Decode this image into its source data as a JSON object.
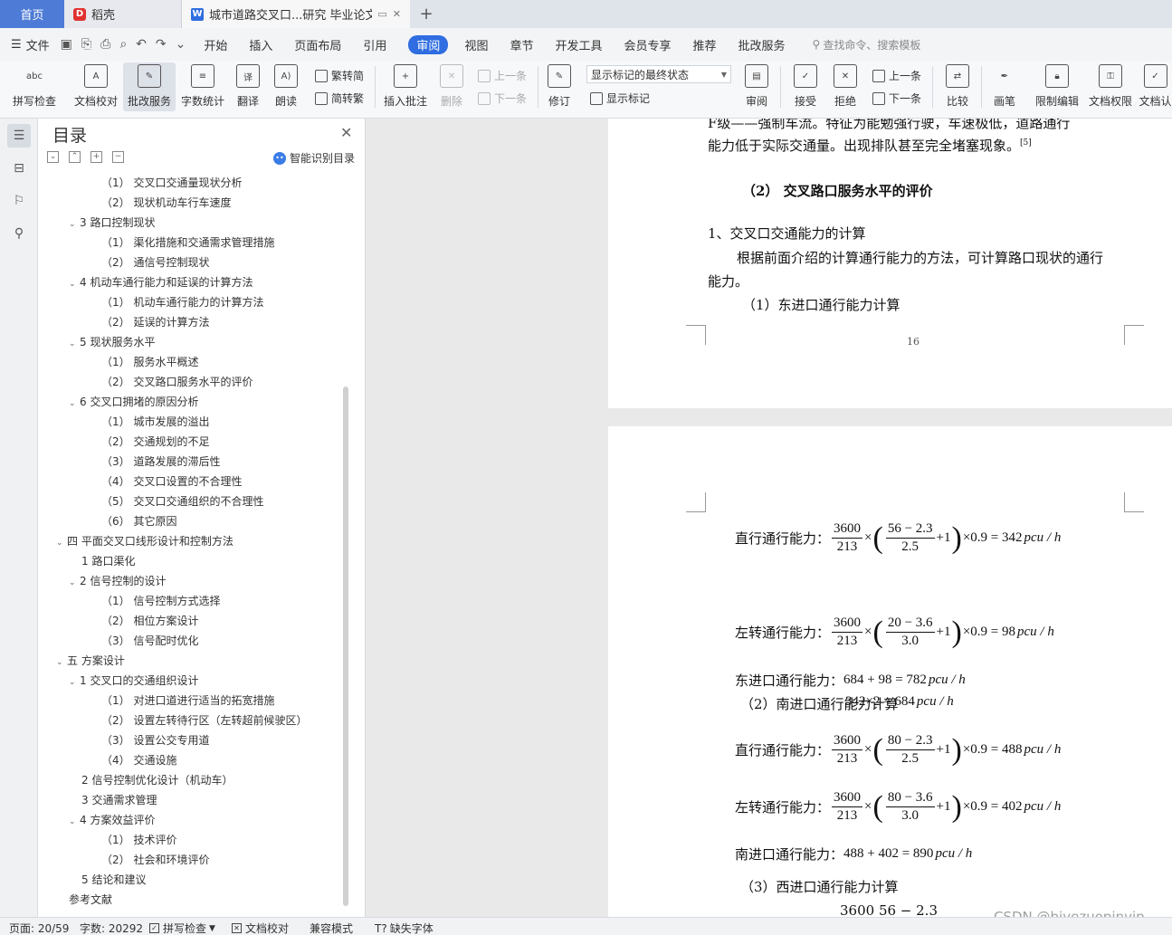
{
  "tabs": {
    "home": "首页",
    "daoke": "稻壳",
    "doc_title": "城市道路交叉口...研究 毕业论文"
  },
  "menu": {
    "file": "文件",
    "items": [
      "开始",
      "插入",
      "页面布局",
      "引用",
      "审阅",
      "视图",
      "章节",
      "开发工具",
      "会员专享",
      "推荐",
      "批改服务"
    ],
    "active": "审阅",
    "search_placeholder": "查找命令、搜索模板"
  },
  "ribbon": {
    "spell": "拼写检查",
    "doc_check": "文档校对",
    "grading": "批改服务",
    "word_count": "字数统计",
    "translate": "翻译",
    "read_aloud": "朗读",
    "trad": "繁转简",
    "simp": "简转繁",
    "insert_comment": "插入批注",
    "delete": "删除",
    "prev": "上一条",
    "next": "下一条",
    "track": "修订",
    "markup_select": "显示标记的最终状态",
    "show_markup": "显示标记",
    "review": "审阅",
    "accept": "接受",
    "reject": "拒绝",
    "prev2": "上一条",
    "next2": "下一条",
    "compare": "比较",
    "pen": "画笔",
    "restrict": "限制编辑",
    "rights": "文档权限",
    "auth": "文档认"
  },
  "toc": {
    "title": "目录",
    "smart": "智能识别目录",
    "items": [
      {
        "text": "（1） 交叉口交通量现状分析",
        "lvl": 2
      },
      {
        "text": "（2） 现状机动车行车速度",
        "lvl": 2
      },
      {
        "text": "3 路口控制现状",
        "lvl": 1,
        "car": "⌄"
      },
      {
        "text": "（1） 渠化措施和交通需求管理措施",
        "lvl": 2
      },
      {
        "text": "（2） 通信号控制现状",
        "lvl": 2
      },
      {
        "text": "4 机动车通行能力和延误的计算方法",
        "lvl": 1,
        "car": "⌄"
      },
      {
        "text": "（1） 机动车通行能力的计算方法",
        "lvl": 2
      },
      {
        "text": "（2） 延误的计算方法",
        "lvl": 2
      },
      {
        "text": "5 现状服务水平",
        "lvl": 1,
        "car": "⌄"
      },
      {
        "text": "（1） 服务水平概述",
        "lvl": 2
      },
      {
        "text": "（2） 交叉路口服务水平的评价",
        "lvl": 2
      },
      {
        "text": "6 交叉口拥堵的原因分析",
        "lvl": 1,
        "car": "⌄"
      },
      {
        "text": "（1） 城市发展的溢出",
        "lvl": 2
      },
      {
        "text": "（2） 交通规划的不足",
        "lvl": 2
      },
      {
        "text": "（3） 道路发展的滞后性",
        "lvl": 2
      },
      {
        "text": "（4） 交叉口设置的不合理性",
        "lvl": 2
      },
      {
        "text": "（5） 交叉口交通组织的不合理性",
        "lvl": 2
      },
      {
        "text": "（6） 其它原因",
        "lvl": 2
      },
      {
        "text": "四 平面交叉口线形设计和控制方法",
        "lvl": 0,
        "car": "⌄"
      },
      {
        "text": "1 路口渠化",
        "lvl": 1
      },
      {
        "text": "2 信号控制的设计",
        "lvl": 1,
        "car": "⌄"
      },
      {
        "text": "（1） 信号控制方式选择",
        "lvl": 2
      },
      {
        "text": "（2） 相位方案设计",
        "lvl": 2
      },
      {
        "text": "（3） 信号配时优化",
        "lvl": 2
      },
      {
        "text": "五 方案设计",
        "lvl": 0,
        "car": "⌄"
      },
      {
        "text": "1 交叉口的交通组织设计",
        "lvl": 1,
        "car": "⌄"
      },
      {
        "text": "（1） 对进口道进行适当的拓宽措施",
        "lvl": 2
      },
      {
        "text": "（2） 设置左转待行区（左转超前候驶区）",
        "lvl": 2
      },
      {
        "text": "（3） 设置公交专用道",
        "lvl": 2
      },
      {
        "text": "（4） 交通设施",
        "lvl": 2
      },
      {
        "text": "2 信号控制优化设计（机动车）",
        "lvl": 1
      },
      {
        "text": "3 交通需求管理",
        "lvl": 1
      },
      {
        "text": "4 方案效益评价",
        "lvl": 1,
        "car": "⌄"
      },
      {
        "text": "（1） 技术评价",
        "lvl": 2
      },
      {
        "text": "（2） 社会和环境评价",
        "lvl": 2
      },
      {
        "text": "5 结论和建议",
        "lvl": 1
      },
      {
        "text": "参考文献",
        "lvl": 0
      }
    ]
  },
  "page1": {
    "line1": "F级——强制车流。特征为能勉强行驶，车速极低，道路通行",
    "line2": "能力低于实际交通量。出现排队甚至完全堵塞现象。",
    "ref": "[5]",
    "heading": "（2） 交叉路口服务水平的评价",
    "sub1": "1、交叉口交通能力的计算",
    "para1": "根据前面介绍的计算通行能力的方法，可计算路口现状的通行",
    "para2": "能力。",
    "sub2": "（1）东进口通行能力计算",
    "page_number": "16"
  },
  "page2": {
    "eq1_label": "直行通行能力：",
    "eq1": {
      "a": "3600",
      "b": "213",
      "c": "56 − 2.3",
      "d": "2.5",
      "tail": "+1",
      "res": "×0.9 = 342",
      "unit": "pcu / h"
    },
    "eq2": {
      "text": "342×2 = 684",
      "unit": "pcu / h"
    },
    "eq3_label": "左转通行能力：",
    "eq3": {
      "a": "3600",
      "b": "213",
      "c": "20 − 3.6",
      "d": "3.0",
      "tail": "+1",
      "res": "×0.9 = 98",
      "unit": "pcu / h"
    },
    "eq4_label": "东进口通行能力：",
    "eq4": {
      "text": "684 + 98 = 782",
      "unit": "pcu / h"
    },
    "sub3": "（2）南进口通行能力计算",
    "eq5_label": "直行通行能力：",
    "eq5": {
      "a": "3600",
      "b": "213",
      "c": "80 − 2.3",
      "d": "2.5",
      "tail": "+1",
      "res": "×0.9 = 488",
      "unit": "pcu / h"
    },
    "eq6_label": "左转通行能力：",
    "eq6": {
      "a": "3600",
      "b": "213",
      "c": "80 − 3.6",
      "d": "3.0",
      "tail": "+1",
      "res": "×0.9 = 402",
      "unit": "pcu / h"
    },
    "eq7_label": "南进口通行能力：",
    "eq7": {
      "text": "488 + 402 = 890",
      "unit": "pcu / h"
    },
    "sub4": "（3）西进口通行能力计算",
    "eq8_partial": "3600  56 − 2.3"
  },
  "watermark": "CSDN @biyezuopinvip",
  "status": {
    "page": "页面: 20/59",
    "words": "字数: 20292",
    "spell": "拼写检查",
    "doc_check": "文档校对",
    "compat": "兼容模式",
    "missing_font": "缺失字体"
  }
}
